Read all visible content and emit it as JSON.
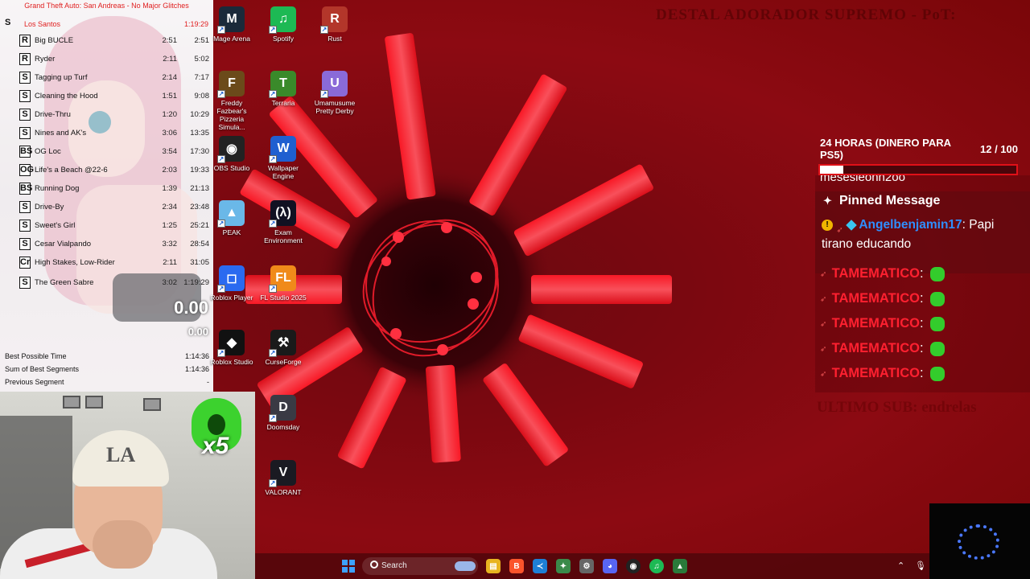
{
  "splits": {
    "game_title": "Grand Theft Auto: San Andreas - No Major Glitches",
    "category": "Los Santos",
    "category_time": "1:19:29",
    "segments": [
      {
        "icon": "R",
        "name": "Big BUCLE",
        "delta": "2:51",
        "time": "2:51"
      },
      {
        "icon": "R",
        "name": "Ryder",
        "delta": "2:11",
        "time": "5:02"
      },
      {
        "icon": "S",
        "name": "Tagging up Turf",
        "delta": "2:14",
        "time": "7:17"
      },
      {
        "icon": "S",
        "name": "Cleaning the Hood",
        "delta": "1:51",
        "time": "9:08"
      },
      {
        "icon": "S",
        "name": "Drive-Thru",
        "delta": "1:20",
        "time": "10:29"
      },
      {
        "icon": "S",
        "name": "Nines and AK's",
        "delta": "3:06",
        "time": "13:35"
      },
      {
        "icon": "BS",
        "name": "OG Loc",
        "delta": "3:54",
        "time": "17:30"
      },
      {
        "icon": "OG",
        "name": "Life's a Beach @22-6",
        "delta": "2:03",
        "time": "19:33"
      },
      {
        "icon": "BS",
        "name": "Running Dog",
        "delta": "1:39",
        "time": "21:13"
      },
      {
        "icon": "S",
        "name": "Drive-By",
        "delta": "2:34",
        "time": "23:48"
      },
      {
        "icon": "S",
        "name": "Sweet's Girl",
        "delta": "1:25",
        "time": "25:21"
      },
      {
        "icon": "S",
        "name": "Cesar Vialpando",
        "delta": "3:32",
        "time": "28:54"
      },
      {
        "icon": "Cr",
        "name": "High Stakes, Low-Rider",
        "delta": "2:11",
        "time": "31:05"
      },
      {
        "icon": "S",
        "name": "The Green Sabre",
        "delta": "3:02",
        "time": "1:19:29"
      }
    ],
    "timer_main": "0.00",
    "timer_segment": "0.00",
    "stats": [
      {
        "label": "Best Possible Time",
        "value": "1:14:36"
      },
      {
        "label": "Sum of Best Segments",
        "value": "1:14:36"
      },
      {
        "label": "Previous Segment",
        "value": "-"
      }
    ]
  },
  "webcam": {
    "cap_logo": "LA",
    "multiplier": "x5"
  },
  "desktop_icons": [
    {
      "label": "Mage Arena",
      "icon": "mage-arena-icon",
      "color": "#1a2a3a",
      "glyph": "M"
    },
    {
      "label": "Spotify",
      "icon": "spotify-icon",
      "color": "#1db954",
      "glyph": "♫"
    },
    {
      "label": "Rust",
      "icon": "rust-icon",
      "color": "#b3362a",
      "glyph": "R"
    },
    {
      "label": "Freddy Fazbear's Pizzeria Simula...",
      "icon": "fnaf-icon",
      "color": "#6b4a1a",
      "glyph": "F"
    },
    {
      "label": "Terraria",
      "icon": "terraria-icon",
      "color": "#3a8a2a",
      "glyph": "T"
    },
    {
      "label": "Umamusume Pretty Derby",
      "icon": "umamusume-icon",
      "color": "#8a6ad8",
      "glyph": "U"
    },
    {
      "label": "OBS Studio",
      "icon": "obs-icon",
      "color": "#222222",
      "glyph": "◉"
    },
    {
      "label": "Wallpaper Engine",
      "icon": "wallpaper-engine-icon",
      "color": "#1f5fd0",
      "glyph": "W"
    },
    {
      "label": "PEAK",
      "icon": "peak-icon",
      "color": "#6ab8e8",
      "glyph": "▲"
    },
    {
      "label": "Exam Environment",
      "icon": "exam-environment-icon",
      "color": "#111122",
      "glyph": "(λ)"
    },
    {
      "label": "Roblox Player",
      "icon": "roblox-player-icon",
      "color": "#2a6af0",
      "glyph": "◻"
    },
    {
      "label": "FL Studio 2025",
      "icon": "fl-studio-icon",
      "color": "#f08a1a",
      "glyph": "FL"
    },
    {
      "label": "Roblox Studio",
      "icon": "roblox-studio-icon",
      "color": "#111111",
      "glyph": "◆"
    },
    {
      "label": "CurseForge",
      "icon": "curseforge-icon",
      "color": "#1a1a1a",
      "glyph": "⚒"
    },
    {
      "label": "Doomsday",
      "icon": "doomsday-icon",
      "color": "#3a3a44",
      "glyph": "D"
    },
    {
      "label": "VALORANT",
      "icon": "valorant-icon",
      "color": "#1a1a22",
      "glyph": "V"
    }
  ],
  "goal": {
    "title": "24 HORAS (DINERO PARA PS5)",
    "current": "12",
    "total": "/ 100",
    "progress_fraction": 0.12
  },
  "chat": {
    "truncated_line": "mesesieonn2oo",
    "pinned_header": "Pinned Message",
    "pinned_user": "Angelbenjamin17",
    "pinned_text": "Papi tirano educando",
    "messages": [
      {
        "user": "TAMEMATICO"
      },
      {
        "user": "TAMEMATICO"
      },
      {
        "user": "TAMEMATICO"
      },
      {
        "user": "TAMEMATICO"
      },
      {
        "user": "TAMEMATICO"
      }
    ]
  },
  "taskbar": {
    "search_placeholder": "Search"
  },
  "colors": {
    "accent_red": "#ff2030",
    "wallpaper_red": "#8c0a12",
    "username_blue": "#2f8fff",
    "emote_green": "#33cc2c"
  }
}
